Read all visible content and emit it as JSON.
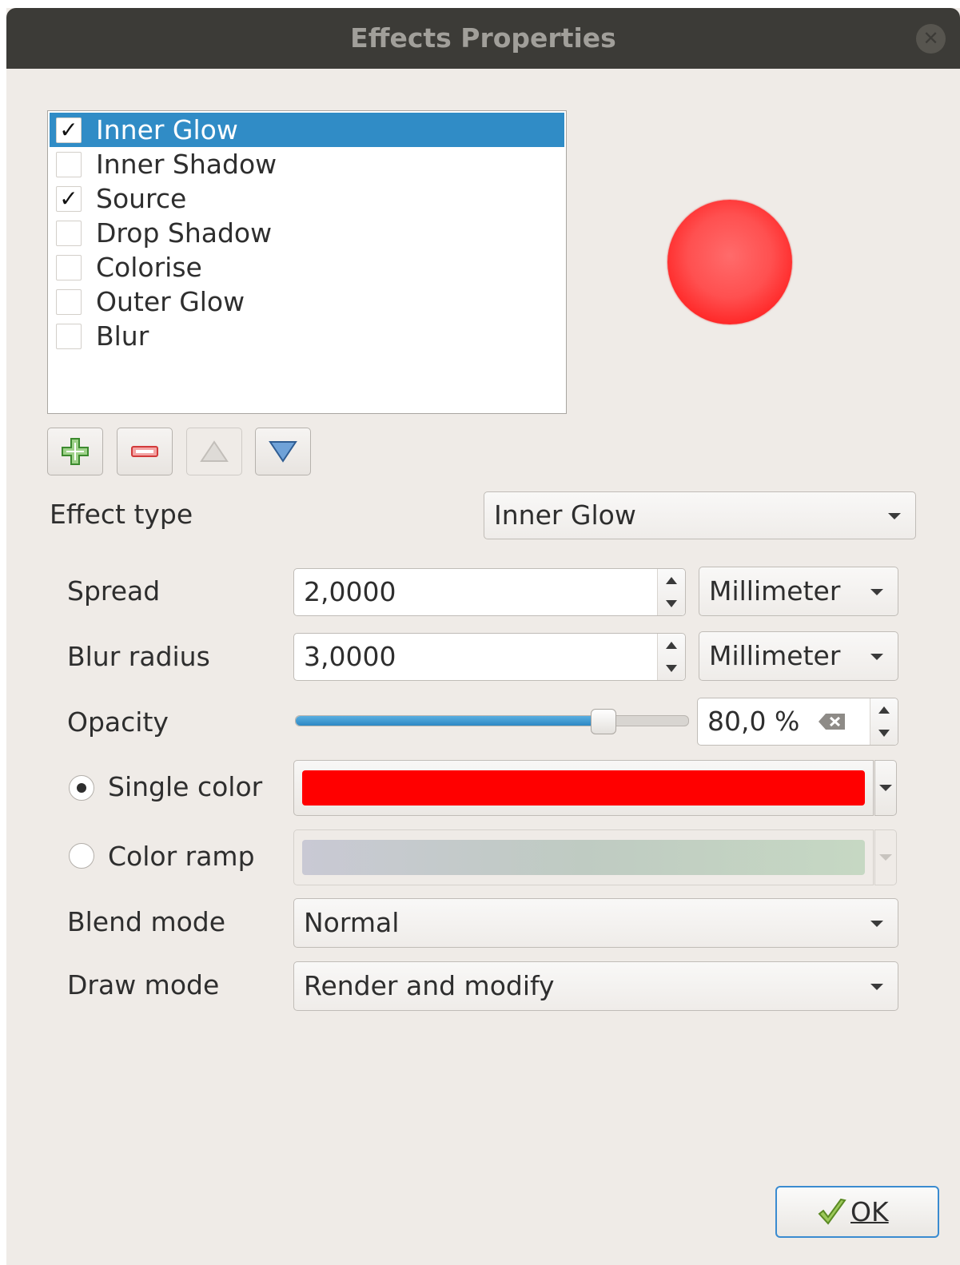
{
  "window": {
    "title": "Effects Properties"
  },
  "effects": [
    {
      "label": "Inner Glow",
      "checked": true,
      "selected": true
    },
    {
      "label": "Inner Shadow",
      "checked": false,
      "selected": false
    },
    {
      "label": "Source",
      "checked": true,
      "selected": false
    },
    {
      "label": "Drop Shadow",
      "checked": false,
      "selected": false
    },
    {
      "label": "Colorise",
      "checked": false,
      "selected": false
    },
    {
      "label": "Outer Glow",
      "checked": false,
      "selected": false
    },
    {
      "label": "Blur",
      "checked": false,
      "selected": false
    }
  ],
  "form": {
    "effect_type_label": "Effect type",
    "effect_type_value": "Inner Glow",
    "spread_label": "Spread",
    "spread_value": "2,0000",
    "spread_unit": "Millimeter",
    "blur_label": "Blur radius",
    "blur_value": "3,0000",
    "blur_unit": "Millimeter",
    "opacity_label": "Opacity",
    "opacity_value": "80,0 %",
    "opacity_fraction": 0.8,
    "single_color_label": "Single color",
    "single_color_selected": true,
    "single_color": "#ff0000",
    "color_ramp_label": "Color ramp",
    "color_ramp_selected": false,
    "blend_label": "Blend mode",
    "blend_value": "Normal",
    "draw_label": "Draw mode",
    "draw_value": "Render and modify"
  },
  "buttons": {
    "ok_label": "OK"
  },
  "icons": {
    "close": "close-icon",
    "add": "plus-icon",
    "remove": "minus-icon",
    "up": "triangle-up-icon",
    "down": "triangle-down-icon",
    "clear": "clear-backspace-icon",
    "ok": "checkmark-icon"
  },
  "colors": {
    "selection": "#308cc6",
    "preview": "#ff3030",
    "accent": "#3a8bd0"
  }
}
